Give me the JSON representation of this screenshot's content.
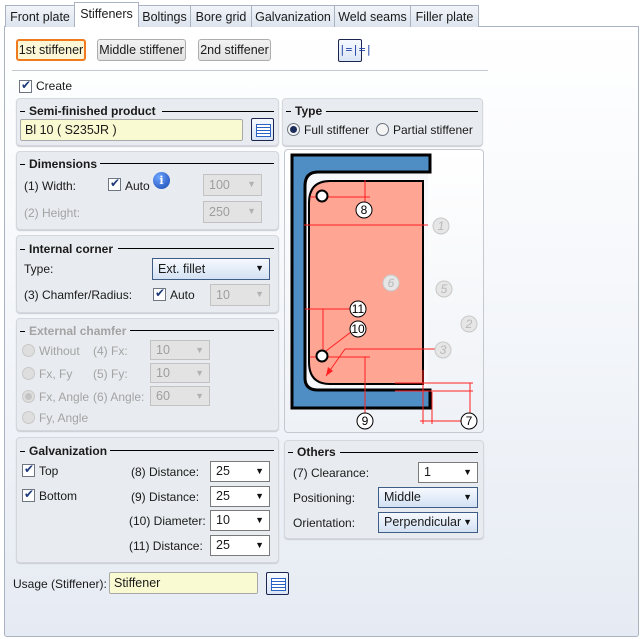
{
  "tabs": [
    "Front plate",
    "Stiffeners",
    "Boltings",
    "Bore grid",
    "Galvanization",
    "Weld seams",
    "Filler plate"
  ],
  "stiffener_buttons": {
    "first": "1st stiffener",
    "middle": "Middle stiffener",
    "second": "2nd stiffener",
    "symmetry_icon": "symmetric-distribution-icon"
  },
  "create": {
    "label": "Create",
    "checked": true
  },
  "semi_finished": {
    "title": "Semi-finished product",
    "value": "Bl 10  ( S235JR )",
    "catalog_icon": "catalog-icon"
  },
  "type": {
    "title": "Type",
    "options": [
      "Full stiffener",
      "Partial stiffener"
    ],
    "selected": "Full stiffener"
  },
  "dimensions": {
    "title": "Dimensions",
    "width_label": "(1) Width:",
    "auto_label": "Auto",
    "auto_checked": true,
    "width_value": "100",
    "height_label": "(2) Height:",
    "height_value": "250",
    "info_icon": "info-icon"
  },
  "internal_corner": {
    "title": "Internal corner",
    "type_label": "Type:",
    "type_value": "Ext. fillet",
    "chamfer_label": "(3) Chamfer/Radius:",
    "auto_label": "Auto",
    "auto_checked": true,
    "chamfer_value": "10"
  },
  "external_chamfer": {
    "title": "External chamfer",
    "options": [
      "Without",
      "Fx, Fy",
      "Fx, Angle",
      "Fy, Angle"
    ],
    "selected": "Fx, Angle",
    "fx_label": "(4) Fx:",
    "fx_value": "10",
    "fy_label": "(5) Fy:",
    "fy_value": "10",
    "angle_label": "(6) Angle:",
    "angle_value": "60"
  },
  "diagram": {
    "labels": [
      "8",
      "1",
      "6",
      "5",
      "2",
      "11",
      "10",
      "3",
      "9",
      "7"
    ],
    "colors": {
      "profile": "#4f8ec4",
      "plate": "#ffa594",
      "dimension": "#ff2020"
    }
  },
  "galvanization": {
    "title": "Galvanization",
    "top_label": "Top",
    "top_checked": true,
    "bottom_label": "Bottom",
    "bottom_checked": true,
    "rows": [
      {
        "label": "(8) Distance:",
        "value": "25"
      },
      {
        "label": "(9) Distance:",
        "value": "25"
      },
      {
        "label": "(10) Diameter:",
        "value": "10"
      },
      {
        "label": "(11) Distance:",
        "value": "25"
      }
    ]
  },
  "others": {
    "title": "Others",
    "clearance_label": "(7) Clearance:",
    "clearance_value": "1",
    "positioning_label": "Positioning:",
    "positioning_value": "Middle",
    "orientation_label": "Orientation:",
    "orientation_value": "Perpendicular"
  },
  "usage": {
    "label": "Usage (Stiffener):",
    "value": "Stiffener"
  }
}
